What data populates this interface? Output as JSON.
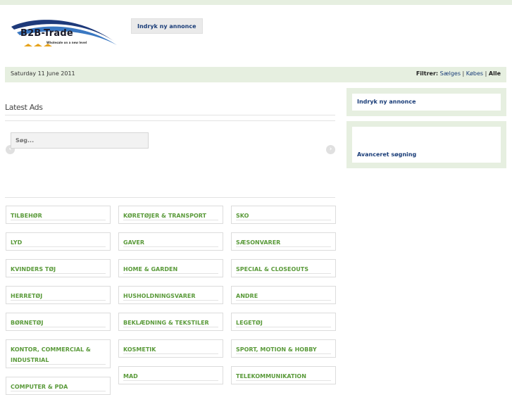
{
  "logo": {
    "name": "B2B-Trade",
    "tagline": "Wholesale on a new level"
  },
  "header": {
    "post_ad_label": "Indryk ny annonce"
  },
  "datebar": {
    "date": "Saturday 11 June 2011",
    "filter_label": "Filtrer:",
    "filter_sell": "Sælges",
    "filter_buy": "Købes",
    "filter_all": "Alle",
    "separator": "|"
  },
  "latest": {
    "title": "Latest Ads",
    "prev_symbol": "‹",
    "next_symbol": "›"
  },
  "sidebar": {
    "post_ad_label": "Indryk ny annonce",
    "search_placeholder": "Søg...",
    "advanced_search_label": "Avanceret søgning"
  },
  "categories": {
    "col1": [
      "TILBEHØR",
      "LYD",
      "KVINDERS TØJ",
      "HERRETØJ",
      "BØRNETØJ",
      "KONTOR, COMMERCIAL & INDUSTRIAL",
      "COMPUTER & PDA"
    ],
    "col2": [
      "KØRETØJER & TRANSPORT",
      "GAVER",
      "HOME & GARDEN",
      "HUSHOLDNINGSVARER",
      "BEKLÆDNING & TEKSTILER",
      "KOSMETIK",
      "MAD"
    ],
    "col3": [
      "SKO",
      "SÆSONVARER",
      "SPECIAL & CLOSEOUTS",
      "ANDRE",
      "LEGETØJ",
      "SPORT, MOTION & HOBBY",
      "TELEKOMMUNIKATION"
    ]
  },
  "colors": {
    "accent_green": "#5a9a3a",
    "link_blue": "#1a3d78",
    "panel_green": "#e6efe0"
  }
}
